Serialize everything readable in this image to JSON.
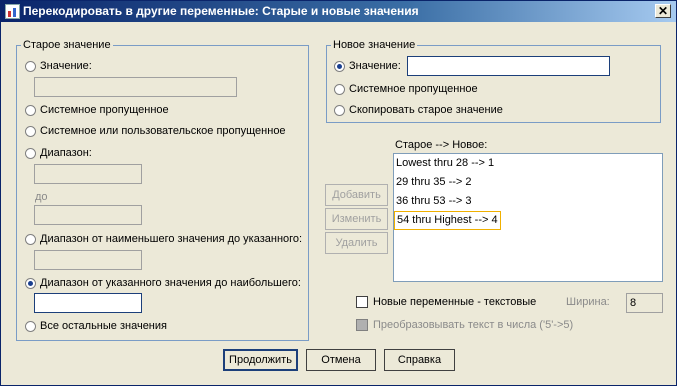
{
  "window": {
    "title": "Перекодировать в другие переменные: Старые и новые значения",
    "close_symbol": "✕"
  },
  "old_value": {
    "legend": "Старое значение",
    "value_label": "Значение:",
    "system_missing_label": "Системное пропущенное",
    "system_or_user_missing_label": "Системное или пользовательское пропущенное",
    "range_label": "Диапазон:",
    "through_label": "до",
    "range_lowest_label": "Диапазон от наименьшего значения до указанного:",
    "range_highest_label": "Диапазон от указанного значения до наибольшего:",
    "all_other_label": "Все остальные значения",
    "selected": "range_highest"
  },
  "new_value": {
    "legend": "Новое значение",
    "value_label": "Значение:",
    "value": "",
    "system_missing_label": "Системное пропущенное",
    "copy_old_label": "Скопировать старое значение",
    "selected": "value"
  },
  "mapping": {
    "label": "Старое --> Новое:",
    "items": [
      "Lowest thru 28 --> 1",
      "29 thru 35 --> 2",
      "36 thru 53 --> 3",
      "54 thru Highest --> 4"
    ],
    "selected_index": 3,
    "add_label": "Добавить",
    "change_label": "Изменить",
    "remove_label": "Удалить"
  },
  "options": {
    "string_vars_label": "Новые переменные - текстовые",
    "width_label": "Ширина:",
    "width_value": "8",
    "convert_label": "Преобразовывать текст в числа ('5'->5)"
  },
  "buttons": {
    "continue_label": "Продолжить",
    "cancel_label": "Отмена",
    "help_label": "Справка"
  }
}
